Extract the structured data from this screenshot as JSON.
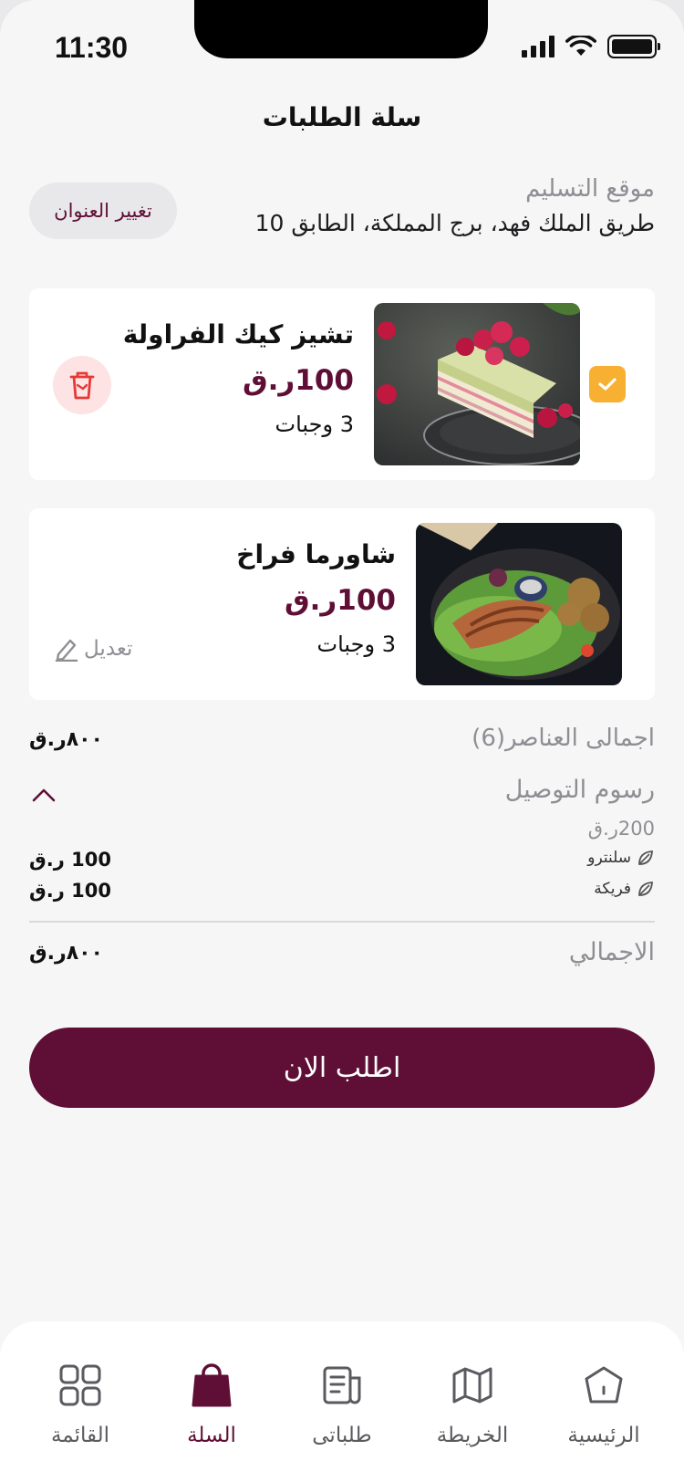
{
  "status_bar": {
    "time": "11:30"
  },
  "page_title": "سلة الطلبات",
  "delivery": {
    "label": "موقع التسليم",
    "address": "طريق الملك فهد، برج المملكة، الطابق 10",
    "change_button": "تغيير العنوان"
  },
  "cart_items": [
    {
      "name": "تشيز كيك الفراولة",
      "price": "100ر.ق",
      "quantity": "3 وجبات",
      "selected": true,
      "action": "delete"
    },
    {
      "name": "شاورما فراخ",
      "price": "100ر.ق",
      "quantity": "3 وجبات",
      "action_label": "تعديل"
    }
  ],
  "summary": {
    "items_label": "اجمالى العناصر(6)",
    "items_value": "٨٠٠ر.ق",
    "delivery_fee_label": "رسوم التوصيل",
    "delivery_fee_amount": "200ر.ق",
    "addons": [
      {
        "name": "سلنترو",
        "value": "100 ر.ق"
      },
      {
        "name": "فريكة",
        "value": "100 ر.ق"
      }
    ],
    "total_label": "الاجمالي",
    "total_value": "٨٠٠ر.ق"
  },
  "order_button": "اطلب الان",
  "bottom_nav": [
    {
      "label": "القائمة",
      "icon": "grid-icon",
      "active": false
    },
    {
      "label": "السلة",
      "icon": "bag-icon",
      "active": true
    },
    {
      "label": "طلباتى",
      "icon": "orders-icon",
      "active": false
    },
    {
      "label": "الخريطة",
      "icon": "map-icon",
      "active": false
    },
    {
      "label": "الرئيسية",
      "icon": "home-icon",
      "active": false
    }
  ],
  "colors": {
    "brand": "#5f0f35",
    "checkbox": "#f7b031",
    "delete": "#e53935"
  }
}
